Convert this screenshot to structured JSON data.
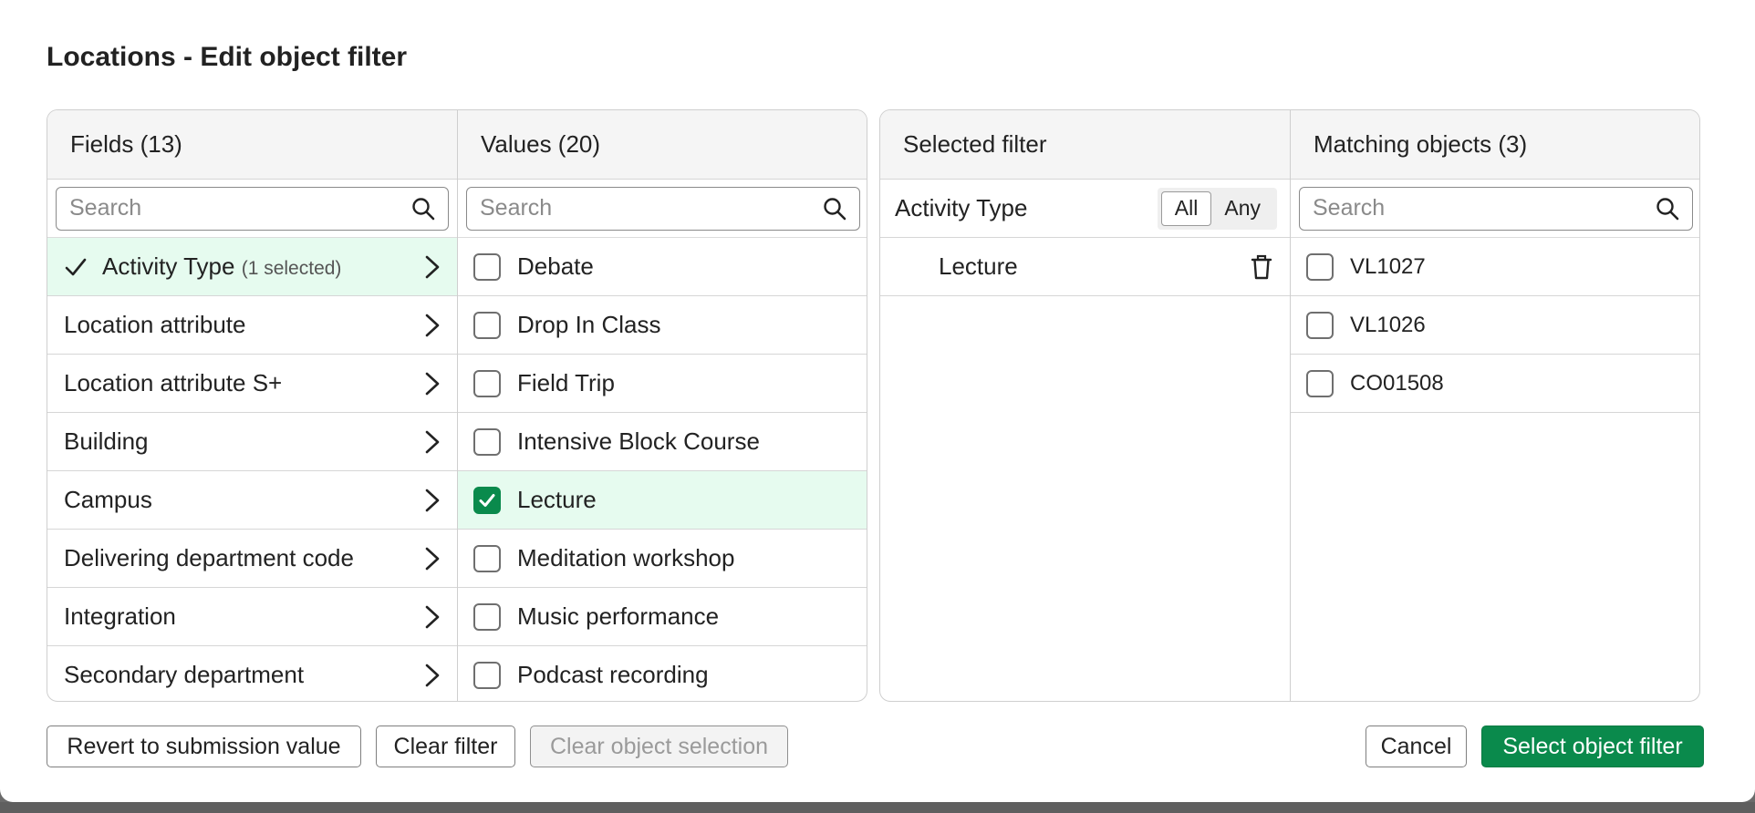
{
  "dialog": {
    "title": "Locations - Edit object filter"
  },
  "fields": {
    "header": "Fields (13)",
    "search_placeholder": "Search",
    "items": [
      {
        "label": "Activity Type",
        "note": "(1 selected)",
        "selected": true
      },
      {
        "label": "Location attribute"
      },
      {
        "label": "Location attribute S+"
      },
      {
        "label": "Building"
      },
      {
        "label": "Campus"
      },
      {
        "label": "Delivering department code"
      },
      {
        "label": "Integration"
      },
      {
        "label": "Secondary department"
      }
    ]
  },
  "values": {
    "header": "Values (20)",
    "search_placeholder": "Search",
    "items": [
      {
        "label": "Debate",
        "checked": false
      },
      {
        "label": "Drop In Class",
        "checked": false
      },
      {
        "label": "Field Trip",
        "checked": false
      },
      {
        "label": "Intensive Block Course",
        "checked": false
      },
      {
        "label": "Lecture",
        "checked": true
      },
      {
        "label": "Meditation workshop",
        "checked": false
      },
      {
        "label": "Music performance",
        "checked": false
      },
      {
        "label": "Podcast recording",
        "checked": false
      }
    ]
  },
  "selected_filter": {
    "header": "Selected filter",
    "group_label": "Activity Type",
    "toggle": {
      "all": "All",
      "any": "Any",
      "active": "All"
    },
    "items": [
      {
        "label": "Lecture"
      }
    ]
  },
  "matching": {
    "header": "Matching objects (3)",
    "search_placeholder": "Search",
    "items": [
      {
        "label": "VL1027"
      },
      {
        "label": "VL1026"
      },
      {
        "label": "CO01508"
      }
    ]
  },
  "buttons": {
    "revert": "Revert to submission value",
    "clear_filter": "Clear filter",
    "clear_selection": "Clear object selection",
    "cancel": "Cancel",
    "select": "Select object filter"
  },
  "colors": {
    "accent": "#0a8a4c",
    "selected_row_bg": "#e6fbef"
  }
}
